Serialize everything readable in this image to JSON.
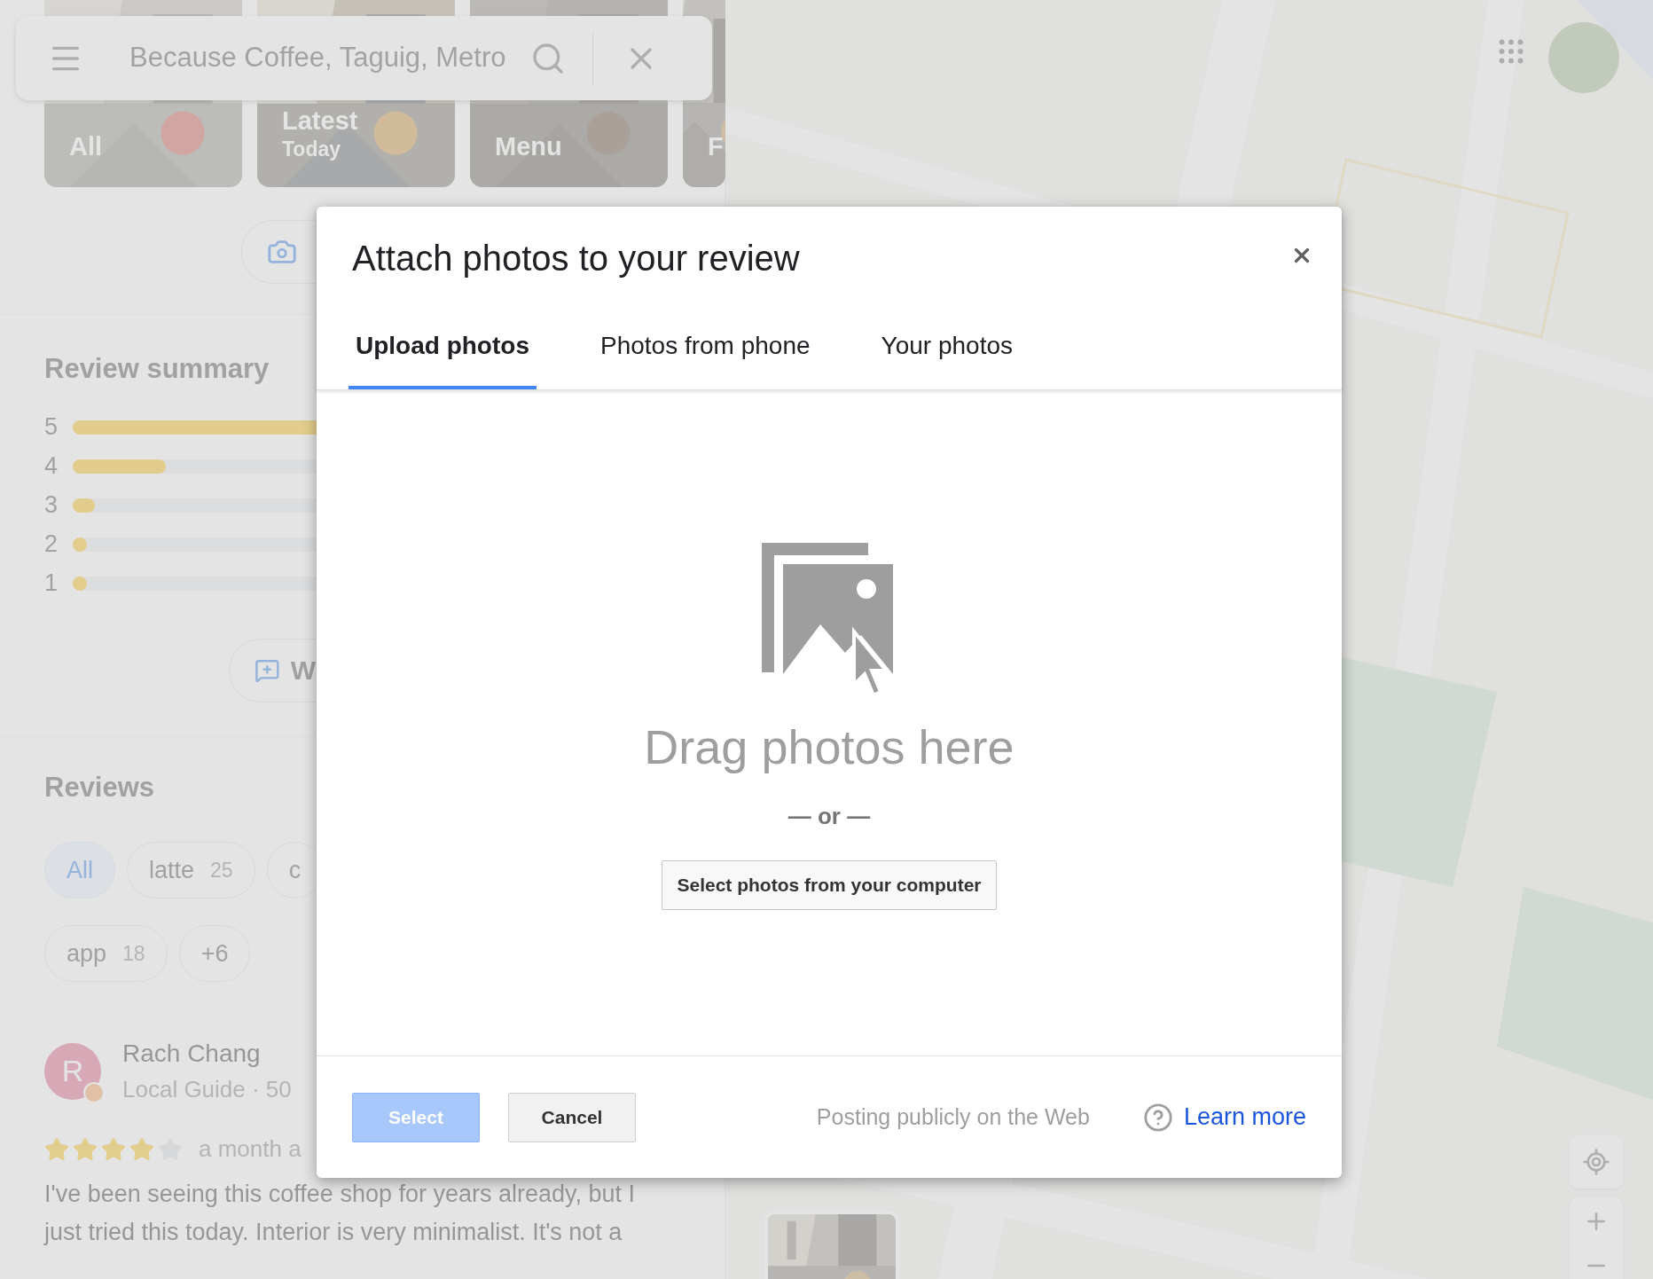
{
  "search": {
    "value": "Because Coffee, Taguig, Metro"
  },
  "photo_tiles": [
    {
      "label": "All"
    },
    {
      "label": "Latest",
      "sublabel": "Today"
    },
    {
      "label": "Menu"
    },
    {
      "label": "F"
    }
  ],
  "review_summary": {
    "title": "Review summary",
    "rows": [
      {
        "label": "5",
        "level": 0.95
      },
      {
        "label": "4",
        "level": 0.21
      },
      {
        "label": "3",
        "level": 0.05
      },
      {
        "label": "2",
        "level": 0.03
      },
      {
        "label": "1",
        "level": 0.03
      }
    ]
  },
  "write_review_button": {
    "label": "W"
  },
  "reviews": {
    "title": "Reviews",
    "filter_rows": [
      [
        {
          "label": "All",
          "selected": true
        },
        {
          "label": "latte",
          "count": "25",
          "selected": false
        },
        {
          "label": "c",
          "selected": false
        }
      ],
      [
        {
          "label": "app",
          "count": "18",
          "selected": false
        },
        {
          "label": "+6",
          "selected": false
        }
      ]
    ]
  },
  "review": {
    "initial": "R",
    "name": "Rach Chang",
    "meta": "Local Guide · 50",
    "stars": 4,
    "time": "a month a",
    "text": [
      "I've been seeing this coffee shop for years already, but I",
      "just tried this today. Interior is very minimalist. It's not a"
    ]
  },
  "dialog": {
    "title": "Attach photos to your review",
    "tabs": [
      {
        "label": "Upload photos",
        "selected": true
      },
      {
        "label": "Photos from phone",
        "selected": false
      },
      {
        "label": "Your photos",
        "selected": false
      }
    ],
    "drop_text": "Drag photos here",
    "or_text": "— or —",
    "select_computer_button": "Select photos from your computer",
    "buttons": [
      {
        "label": "Select",
        "disabled": true
      },
      {
        "label": "Cancel",
        "disabled": false
      }
    ],
    "notice": "Posting publicly on the Web",
    "link": "Learn more"
  }
}
